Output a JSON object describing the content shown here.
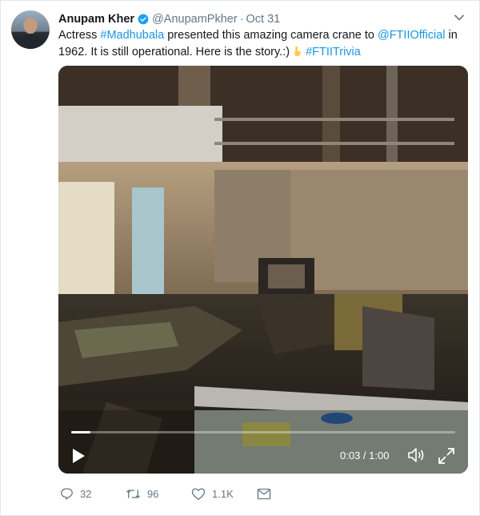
{
  "tweet": {
    "author_name": "Anupam Kher",
    "handle": "@AnupamPkher",
    "separator": "·",
    "date": "Oct 31",
    "text": {
      "part1": "Actress ",
      "hashtag1": "#Madhubala",
      "part2": " presented this amazing camera crane to ",
      "mention": "@FTIIOfficial",
      "part3": " in 1962. It is still operational. Here is the story.:)",
      "hashtag2": "#FTIITrivia"
    }
  },
  "video": {
    "current_time": "0:03",
    "time_separator": " / ",
    "duration": "1:00",
    "progress_fraction": 0.05
  },
  "actions": {
    "reply_count": "32",
    "retweet_count": "96",
    "like_count": "1.1K"
  },
  "colors": {
    "link": "#1b95e0",
    "verified": "#1da1f2",
    "muted": "#657786"
  },
  "icons": {
    "verified": "verified-badge-icon",
    "chevron": "chevron-down-icon",
    "emoji": "pointing-down-hand-emoji",
    "play": "play-icon",
    "volume": "volume-icon",
    "fullscreen": "fullscreen-icon",
    "reply": "reply-icon",
    "retweet": "retweet-icon",
    "like": "heart-icon",
    "dm": "envelope-icon"
  }
}
